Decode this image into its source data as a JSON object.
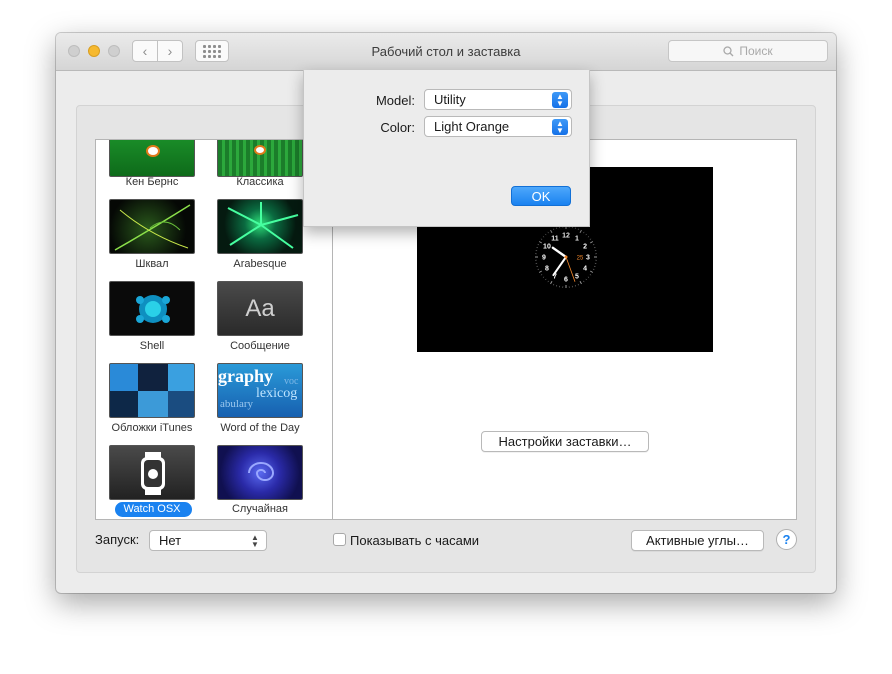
{
  "window": {
    "title": "Рабочий стол и заставка",
    "search_placeholder": "Поиск",
    "nav_back_icon": "‹",
    "nav_forward_icon": "›"
  },
  "screensavers": [
    {
      "label": "Кен Бернс",
      "selected": false
    },
    {
      "label": "Классика",
      "selected": false
    },
    {
      "label": "Шквал",
      "selected": false
    },
    {
      "label": "Arabesque",
      "selected": false
    },
    {
      "label": "Shell",
      "selected": false
    },
    {
      "label": "Сообщение",
      "selected": false
    },
    {
      "label": "Обложки iTunes",
      "selected": false
    },
    {
      "label": "Word of the Day",
      "selected": false
    },
    {
      "label": "Watch OSX",
      "selected": true
    },
    {
      "label": "Случайная",
      "selected": false
    }
  ],
  "thumb_text": {
    "message_aa": "Aa",
    "word_line1": "graphy",
    "word_line2": "lexicog",
    "word_line3": "abulary",
    "word_line4": "voc"
  },
  "options_button": "Настройки заставки…",
  "start": {
    "label": "Запуск:",
    "value": "Нет"
  },
  "show_clock": {
    "label": "Показывать с часами",
    "checked": false
  },
  "hot_corners_button": "Активные углы…",
  "help_label": "?",
  "sheet": {
    "model_label": "Model:",
    "model_value": "Utility",
    "color_label": "Color:",
    "color_value": "Light Orange",
    "ok_label": "OK"
  },
  "clock": {
    "numbers": [
      "12",
      "1",
      "2",
      "3",
      "4",
      "5",
      "6",
      "7",
      "8",
      "9",
      "10",
      "11"
    ],
    "date": "25",
    "accent_color": "#f0862a"
  },
  "colors": {
    "accent": "#1a82f0",
    "preview_bg": "#000000"
  }
}
